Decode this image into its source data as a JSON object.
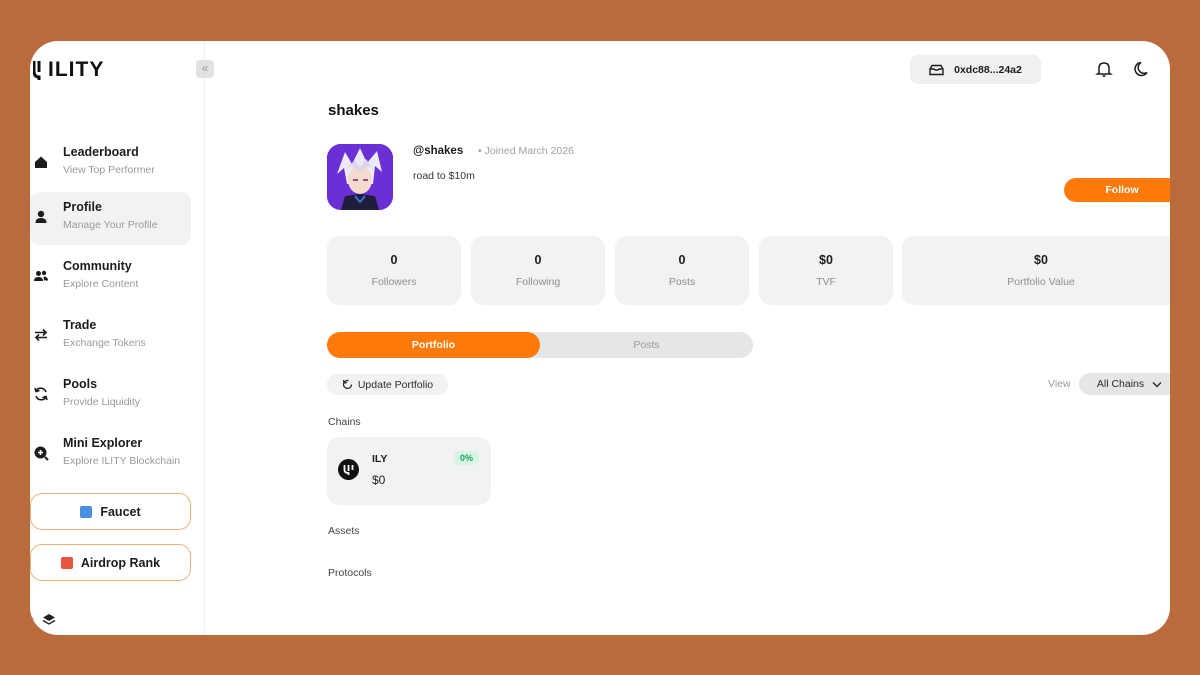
{
  "app": {
    "logo_text": "ILITY",
    "collapse_glyph": "«"
  },
  "sidebar": {
    "items": [
      {
        "label": "Leaderboard",
        "sub": "View Top Performer",
        "icon": "home-icon"
      },
      {
        "label": "Profile",
        "sub": "Manage Your Profile",
        "icon": "user-icon"
      },
      {
        "label": "Community",
        "sub": "Explore Content",
        "icon": "users-icon"
      },
      {
        "label": "Trade",
        "sub": "Exchange Tokens",
        "icon": "swap-icon"
      },
      {
        "label": "Pools",
        "sub": "Provide Liquidity",
        "icon": "refresh-icon"
      },
      {
        "label": "Mini Explorer",
        "sub": "Explore ILITY Blockchain",
        "icon": "search-icon"
      }
    ],
    "faucet_label": "Faucet",
    "airdrop_label": "Airdrop Rank",
    "bottom_glyph": "‹"
  },
  "header": {
    "wallet_address": "0xdc88...24a2"
  },
  "profile": {
    "name": "shakes",
    "handle": "@shakes",
    "joined": "• Joined March 2026",
    "bio": "road to $10m",
    "follow_label": "Follow"
  },
  "stats": [
    {
      "value": "0",
      "label": "Followers"
    },
    {
      "value": "0",
      "label": "Following"
    },
    {
      "value": "0",
      "label": "Posts"
    },
    {
      "value": "$0",
      "label": "TVF"
    },
    {
      "value": "$0",
      "label": "Portfolio Value"
    }
  ],
  "tabs": {
    "portfolio": "Portfolio",
    "posts": "Posts"
  },
  "portfolio": {
    "update_label": "Update Portfolio",
    "view_label": "View",
    "chain_filter": "All Chains",
    "chains_heading": "Chains",
    "assets_heading": "Assets",
    "protocols_heading": "Protocols",
    "chain_card": {
      "name": "ILY",
      "value": "$0",
      "percent": "0%"
    }
  },
  "colors": {
    "accent": "#ff7a0a",
    "background": "#b96b3c",
    "positive": "#19a860"
  }
}
